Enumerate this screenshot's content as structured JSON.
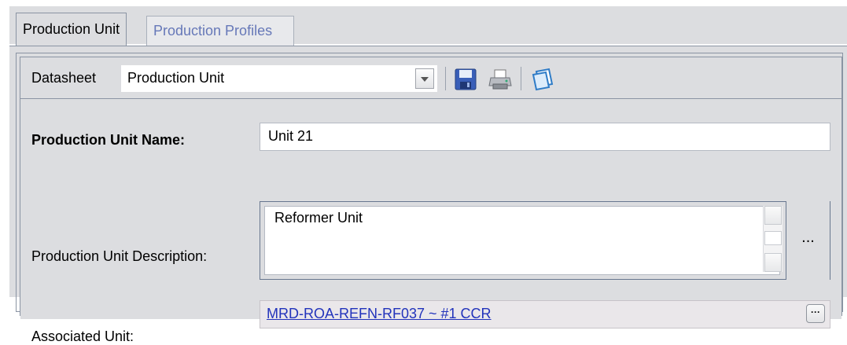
{
  "tabs": [
    {
      "label": "Production Unit",
      "active": true
    },
    {
      "label": "Production Profiles",
      "active": false
    }
  ],
  "toolbar": {
    "datasheet_label": "Datasheet",
    "datasheet_value": "Production Unit",
    "icons": [
      "save-icon",
      "print-icon",
      "copy-datasheet-icon"
    ]
  },
  "form": {
    "name_label": "Production Unit Name:",
    "name_value": "Unit 21",
    "description_label": "Production Unit Description:",
    "description_value": "Reformer Unit",
    "description_more_label": "...",
    "associated_label": "Associated Unit:",
    "associated_value": "MRD-ROA-REFN-RF037 ~ #1 CCR",
    "associated_more_label": "···"
  },
  "colors": {
    "panel_bg": "#dcdde0",
    "inactive_tab_text": "#6678b8",
    "link": "#2233bb",
    "associated_field_bg": "#eae7ea"
  }
}
